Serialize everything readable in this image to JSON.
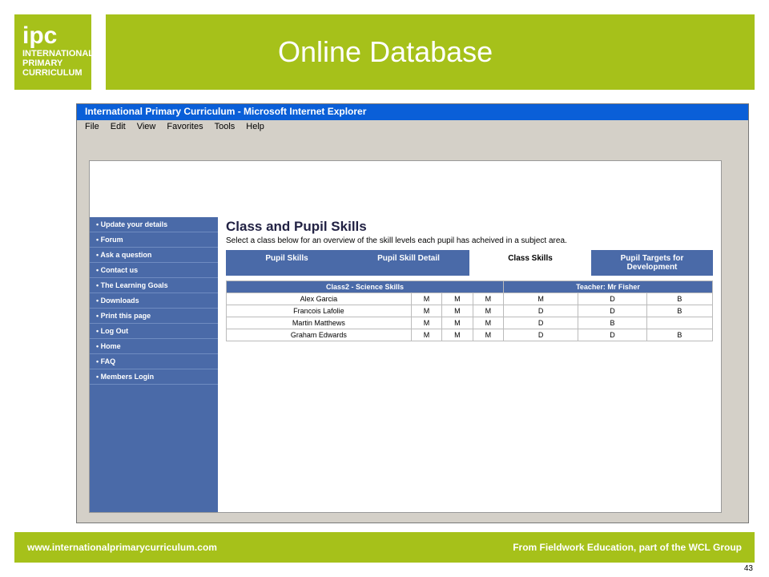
{
  "logo": {
    "ipc": "ipc",
    "l1": "INTERNATIONAL",
    "l2": "PRIMARY",
    "l3": "CURRICULUM"
  },
  "title": "Online Database",
  "ie": {
    "title": "International Primary Curriculum - Microsoft Internet Explorer",
    "menu": [
      "File",
      "Edit",
      "View",
      "Favorites",
      "Tools",
      "Help"
    ]
  },
  "nav": [
    "Update your details",
    "Forum",
    "Ask a question",
    "Contact us",
    "The Learning Goals",
    "Downloads",
    "Print this page",
    "Log Out",
    "Home",
    "FAQ",
    "Members Login"
  ],
  "main": {
    "heading": "Class and Pupil Skills",
    "desc": "Select a class below for an overview of the skill levels each pupil has acheived in a subject area.",
    "tabs": [
      "Pupil Skills",
      "Pupil Skill Detail",
      "Class Skills",
      "Pupil Targets for Development"
    ],
    "class_title": "Class2 - Science Skills",
    "teacher": "Teacher: Mr Fisher"
  },
  "rows": [
    [
      "Alex Garcia",
      "M",
      "M",
      "M",
      "M",
      "D",
      "B"
    ],
    [
      "Francois Lafolie",
      "M",
      "M",
      "M",
      "D",
      "D",
      "B"
    ],
    [
      "Martin Matthews",
      "M",
      "M",
      "M",
      "D",
      "B",
      ""
    ],
    [
      "Graham Edwards",
      "M",
      "M",
      "M",
      "D",
      "D",
      "B"
    ]
  ],
  "footer": {
    "left": "www.internationalprimarycurriculum.com",
    "right": "From Fieldwork Education, part of the WCL Group"
  },
  "page_number": "43"
}
